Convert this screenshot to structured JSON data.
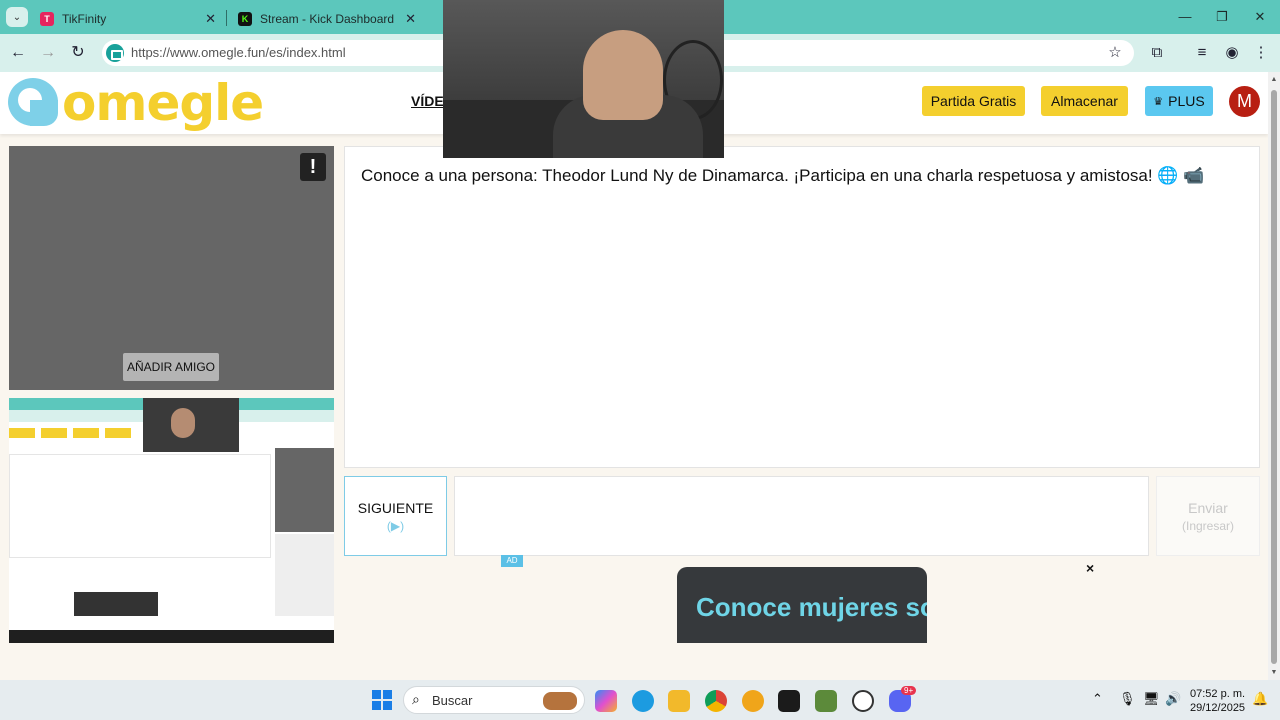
{
  "browser": {
    "tabs": [
      {
        "label": "TikFinity",
        "favicon_color": "#e6245e"
      },
      {
        "label": "Stream - Kick Dashboard",
        "favicon_color": "#111111"
      }
    ],
    "url": "https://www.omegle.fun/es/index.html"
  },
  "header": {
    "logo_text": "omegle",
    "nav_label": "VÍDE",
    "buttons": {
      "free_game": "Partida Gratis",
      "store": "Almacenar",
      "plus": "PLUS"
    },
    "avatar_letter": "M",
    "colors": {
      "yellow": "#f4cf2e",
      "plus_blue": "#5bc8f0",
      "avatar": "#b81f12"
    }
  },
  "video": {
    "report_icon": "!",
    "add_friend_label": "AÑADIR AMIGO"
  },
  "chat": {
    "intro_message": "Conoce a una persona: Theodor Lund Ny de Dinamarca. ¡Participa en una charla respetuosa y amistosa! 🌐 📹",
    "next_label": "SIGUIENTE",
    "next_hint": "(▶)",
    "send_label": "Enviar",
    "send_hint": "(Ingresar)"
  },
  "ad": {
    "tag": "AD",
    "close": "×",
    "headline": "Conoce mujeres solteras"
  },
  "taskbar": {
    "search_placeholder": "Buscar",
    "time": "07:52 p. m.",
    "date": "29/12/2025",
    "notification_count": "9+"
  }
}
